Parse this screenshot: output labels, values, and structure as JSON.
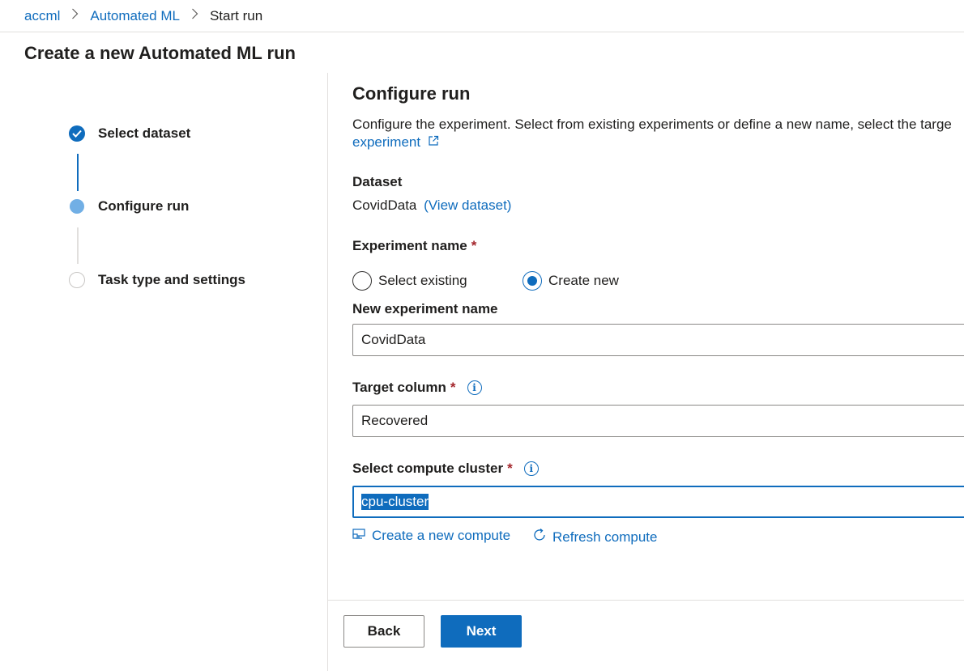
{
  "breadcrumb": {
    "items": [
      "accml",
      "Automated ML",
      "Start run"
    ]
  },
  "page_title": "Create a new Automated ML run",
  "steps": [
    {
      "label": "Select dataset",
      "state": "done"
    },
    {
      "label": "Configure run",
      "state": "current"
    },
    {
      "label": "Task type and settings",
      "state": "todo"
    }
  ],
  "configure": {
    "title": "Configure run",
    "description": "Configure the experiment. Select from existing experiments or define a new name, select the targe",
    "learn_link": "experiment",
    "dataset_label": "Dataset",
    "dataset_value": "CovidData",
    "dataset_link": "(View dataset)",
    "experiment_label": "Experiment name",
    "required_mark": "*",
    "radio_existing": "Select existing",
    "radio_new": "Create new",
    "new_experiment_label": "New experiment name",
    "new_experiment_value": "CovidData",
    "target_label": "Target column",
    "target_value": "Recovered",
    "compute_label": "Select compute cluster",
    "compute_value": "cpu-cluster",
    "create_compute": "Create a new compute",
    "refresh_compute": "Refresh compute"
  },
  "footer": {
    "back": "Back",
    "next": "Next"
  },
  "colors": {
    "accent": "#0f6cbd",
    "required": "#a4262c",
    "current_step": "#71afe5"
  }
}
